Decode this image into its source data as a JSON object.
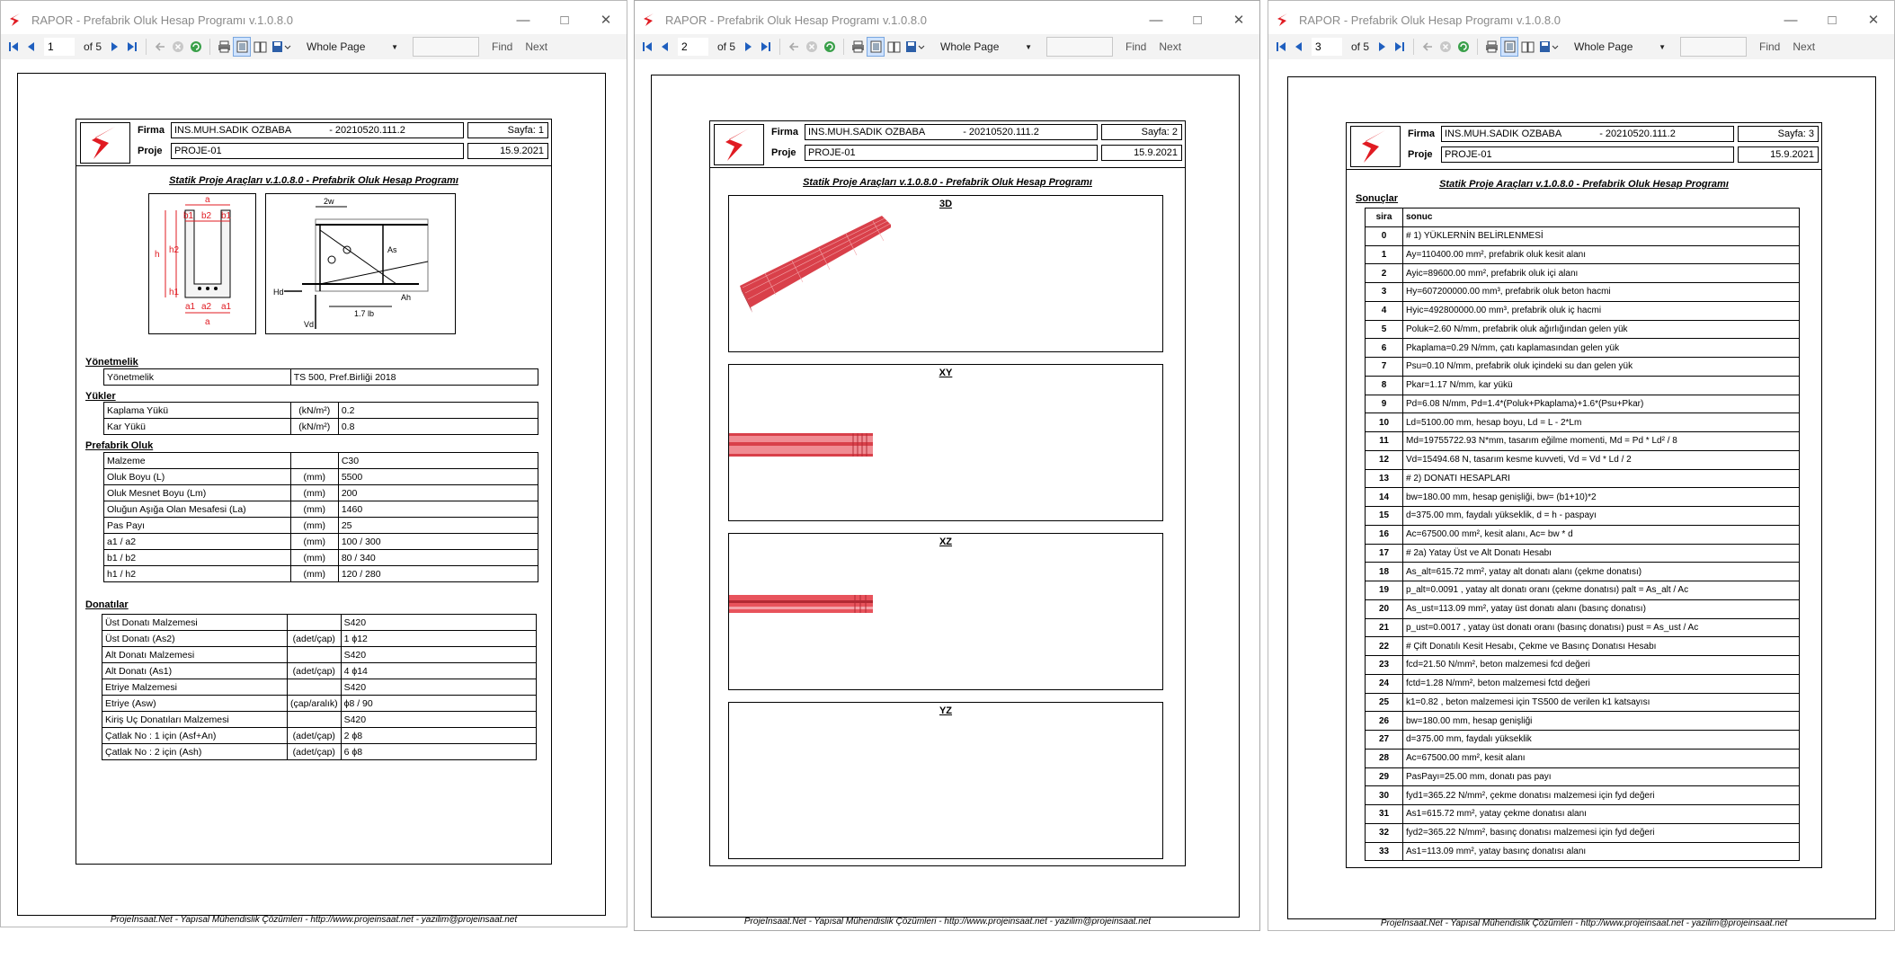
{
  "window": {
    "title": "RAPOR - Prefabrik Oluk Hesap Programı v.1.0.8.0",
    "page_of": "of 5",
    "zoom": "Whole Page",
    "find_label": "Find",
    "next_label": "Next"
  },
  "report": {
    "firma_label": "Firma",
    "proje_label": "Proje",
    "firma_value": "INS.MUH.SADIK OZBABA",
    "firma_code": "- 20210520.111.2",
    "proje_value": "PROJE-01",
    "date": "15.9.2021",
    "doc_title": "Statik Proje Araçları v.1.0.8.0 - Prefabrik Oluk Hesap Programı",
    "footer": "ProjeInsaat.Net - Yapısal Mühendislik Çözümleri - http://www.projeinsaat.net - yazilim@projeinsaat.net"
  },
  "pages": [
    {
      "num": "1",
      "sayfa": "Sayfa: 1"
    },
    {
      "num": "2",
      "sayfa": "Sayfa: 2"
    },
    {
      "num": "3",
      "sayfa": "Sayfa: 3"
    }
  ],
  "page1": {
    "drawing_labels": {
      "a": "a",
      "b1": "b1",
      "b2": "b2",
      "h": "h",
      "h1": "h1",
      "h2": "h2",
      "a1": "a1",
      "a2": "a2",
      "w2": "2w",
      "l17": "1.7 lb",
      "Hd": "Hd",
      "Vd": "Vd",
      "Asf": "As",
      "Ah": "Ah"
    },
    "yonetmelik_title": "Yönetmelik",
    "yonetmelik": [
      [
        "Yönetmelik",
        "TS 500, Pref.Birliği 2018"
      ]
    ],
    "yukler_title": "Yükler",
    "yukler": [
      [
        "Kaplama Yükü",
        "(kN/m²)",
        "0.2"
      ],
      [
        "Kar Yükü",
        "(kN/m²)",
        "0.8"
      ]
    ],
    "oluk_title": "Prefabrik Oluk",
    "oluk": [
      [
        "Malzeme",
        "",
        "C30"
      ],
      [
        "Oluk Boyu (L)",
        "(mm)",
        "5500"
      ],
      [
        "Oluk Mesnet Boyu (Lm)",
        "(mm)",
        "200"
      ],
      [
        "Oluğun Aşığa Olan Mesafesi (La)",
        "(mm)",
        "1460"
      ],
      [
        "Pas Payı",
        "(mm)",
        "25"
      ],
      [
        "a1 / a2",
        "(mm)",
        "100 / 300"
      ],
      [
        "b1 / b2",
        "(mm)",
        "80 / 340"
      ],
      [
        "h1 / h2",
        "(mm)",
        "120 / 280"
      ]
    ],
    "donati_title": "Donatılar",
    "donati": [
      [
        "Üst Donatı Malzemesi",
        "",
        "S420"
      ],
      [
        "Üst Donatı (As2)",
        "(adet/çap)",
        "1 ϕ12"
      ],
      [
        "Alt Donatı Malzemesi",
        "",
        "S420"
      ],
      [
        "Alt Donatı (As1)",
        "(adet/çap)",
        "4 ϕ14"
      ],
      [
        "Etriye Malzemesi",
        "",
        "S420"
      ],
      [
        "Etriye (Asw)",
        "(çap/aralık)",
        "ϕ8 / 90"
      ],
      [
        "Kiriş Uç Donatıları Malzemesi",
        "",
        "S420"
      ],
      [
        "Çatlak No : 1 için (Asf+An)",
        "(adet/çap)",
        "2 ϕ8"
      ],
      [
        "Çatlak No : 2 için (Ash)",
        "(adet/çap)",
        "6 ϕ8"
      ]
    ]
  },
  "page2": {
    "views": [
      "3D",
      "XY",
      "XZ",
      "YZ"
    ]
  },
  "page3": {
    "sonuclar_title": "Sonuçlar",
    "col_sira": "sira",
    "col_sonuc": "sonuc",
    "rows": [
      [
        "0",
        "# 1) YÜKLERNİN BELİRLENMESİ"
      ],
      [
        "1",
        "Ay=110400.00 mm², prefabrik oluk kesit alanı"
      ],
      [
        "2",
        "Ayic=89600.00 mm², prefabrik oluk içi alanı"
      ],
      [
        "3",
        "Hy=607200000.00 mm³, prefabrik oluk beton hacmi"
      ],
      [
        "4",
        "Hyic=492800000.00 mm³, prefabrik oluk iç hacmi"
      ],
      [
        "5",
        "Poluk=2.60 N/mm, prefabrik oluk ağırlığından gelen yük"
      ],
      [
        "6",
        "Pkaplama=0.29 N/mm, çatı kaplamasından gelen yük"
      ],
      [
        "7",
        "Psu=0.10 N/mm, prefabrik oluk içindeki su dan gelen yük"
      ],
      [
        "8",
        "Pkar=1.17 N/mm, kar yükü"
      ],
      [
        "9",
        "Pd=6.08 N/mm, Pd=1.4*(Poluk+Pkaplama)+1.6*(Psu+Pkar)"
      ],
      [
        "10",
        "Ld=5100.00 mm, hesap boyu, Ld = L - 2*Lm"
      ],
      [
        "11",
        "Md=19755722.93 N*mm, tasarım eğilme momenti, Md = Pd * Ld² / 8"
      ],
      [
        "12",
        "Vd=15494.68 N, tasarım kesme kuvveti, Vd = Vd * Ld / 2"
      ],
      [
        "13",
        "# 2) DONATI HESAPLARI"
      ],
      [
        "14",
        "bw=180.00 mm, hesap genişliği, bw= (b1+10)*2"
      ],
      [
        "15",
        "d=375.00 mm, faydalı yükseklik, d = h - paspayı"
      ],
      [
        "16",
        "Ac=67500.00 mm², kesit alanı, Ac= bw * d"
      ],
      [
        "17",
        "# 2a) Yatay Üst ve Alt Donatı Hesabı"
      ],
      [
        "18",
        "As_alt=615.72 mm², yatay alt donatı alanı (çekme donatısı)"
      ],
      [
        "19",
        "p_alt=0.0091 , yatay alt donatı oranı (çekme donatısı) palt = As_alt / Ac"
      ],
      [
        "20",
        "As_ust=113.09 mm², yatay üst donatı alanı (basınç donatısı)"
      ],
      [
        "21",
        "p_ust=0.0017 , yatay üst donatı oranı (basınç donatısı) pust = As_ust / Ac"
      ],
      [
        "22",
        "# Çift Donatılı Kesit Hesabı, Çekme ve Basınç Donatısı Hesabı"
      ],
      [
        "23",
        "fcd=21.50 N/mm², beton malzemesi fcd değeri"
      ],
      [
        "24",
        "fctd=1.28 N/mm², beton malzemesi fctd değeri"
      ],
      [
        "25",
        "k1=0.82 , beton malzemesi için TS500 de verilen k1 katsayısı"
      ],
      [
        "26",
        "bw=180.00 mm, hesap genişliği"
      ],
      [
        "27",
        "d=375.00 mm, faydalı yükseklik"
      ],
      [
        "28",
        "Ac=67500.00 mm², kesit alanı"
      ],
      [
        "29",
        "PasPayı=25.00 mm, donatı pas payı"
      ],
      [
        "30",
        "fyd1=365.22 N/mm², çekme donatısı malzemesi için fyd değeri"
      ],
      [
        "31",
        "As1=615.72 mm², yatay çekme donatısı alanı"
      ],
      [
        "32",
        "fyd2=365.22 N/mm², basınç donatısı malzemesi için fyd değeri"
      ],
      [
        "33",
        "As1=113.09 mm², yatay basınç donatısı alanı"
      ]
    ]
  },
  "colors": {
    "accent": "#e01b22",
    "nav_blue": "#1f5fbf",
    "beam_red": "#d9404a"
  }
}
